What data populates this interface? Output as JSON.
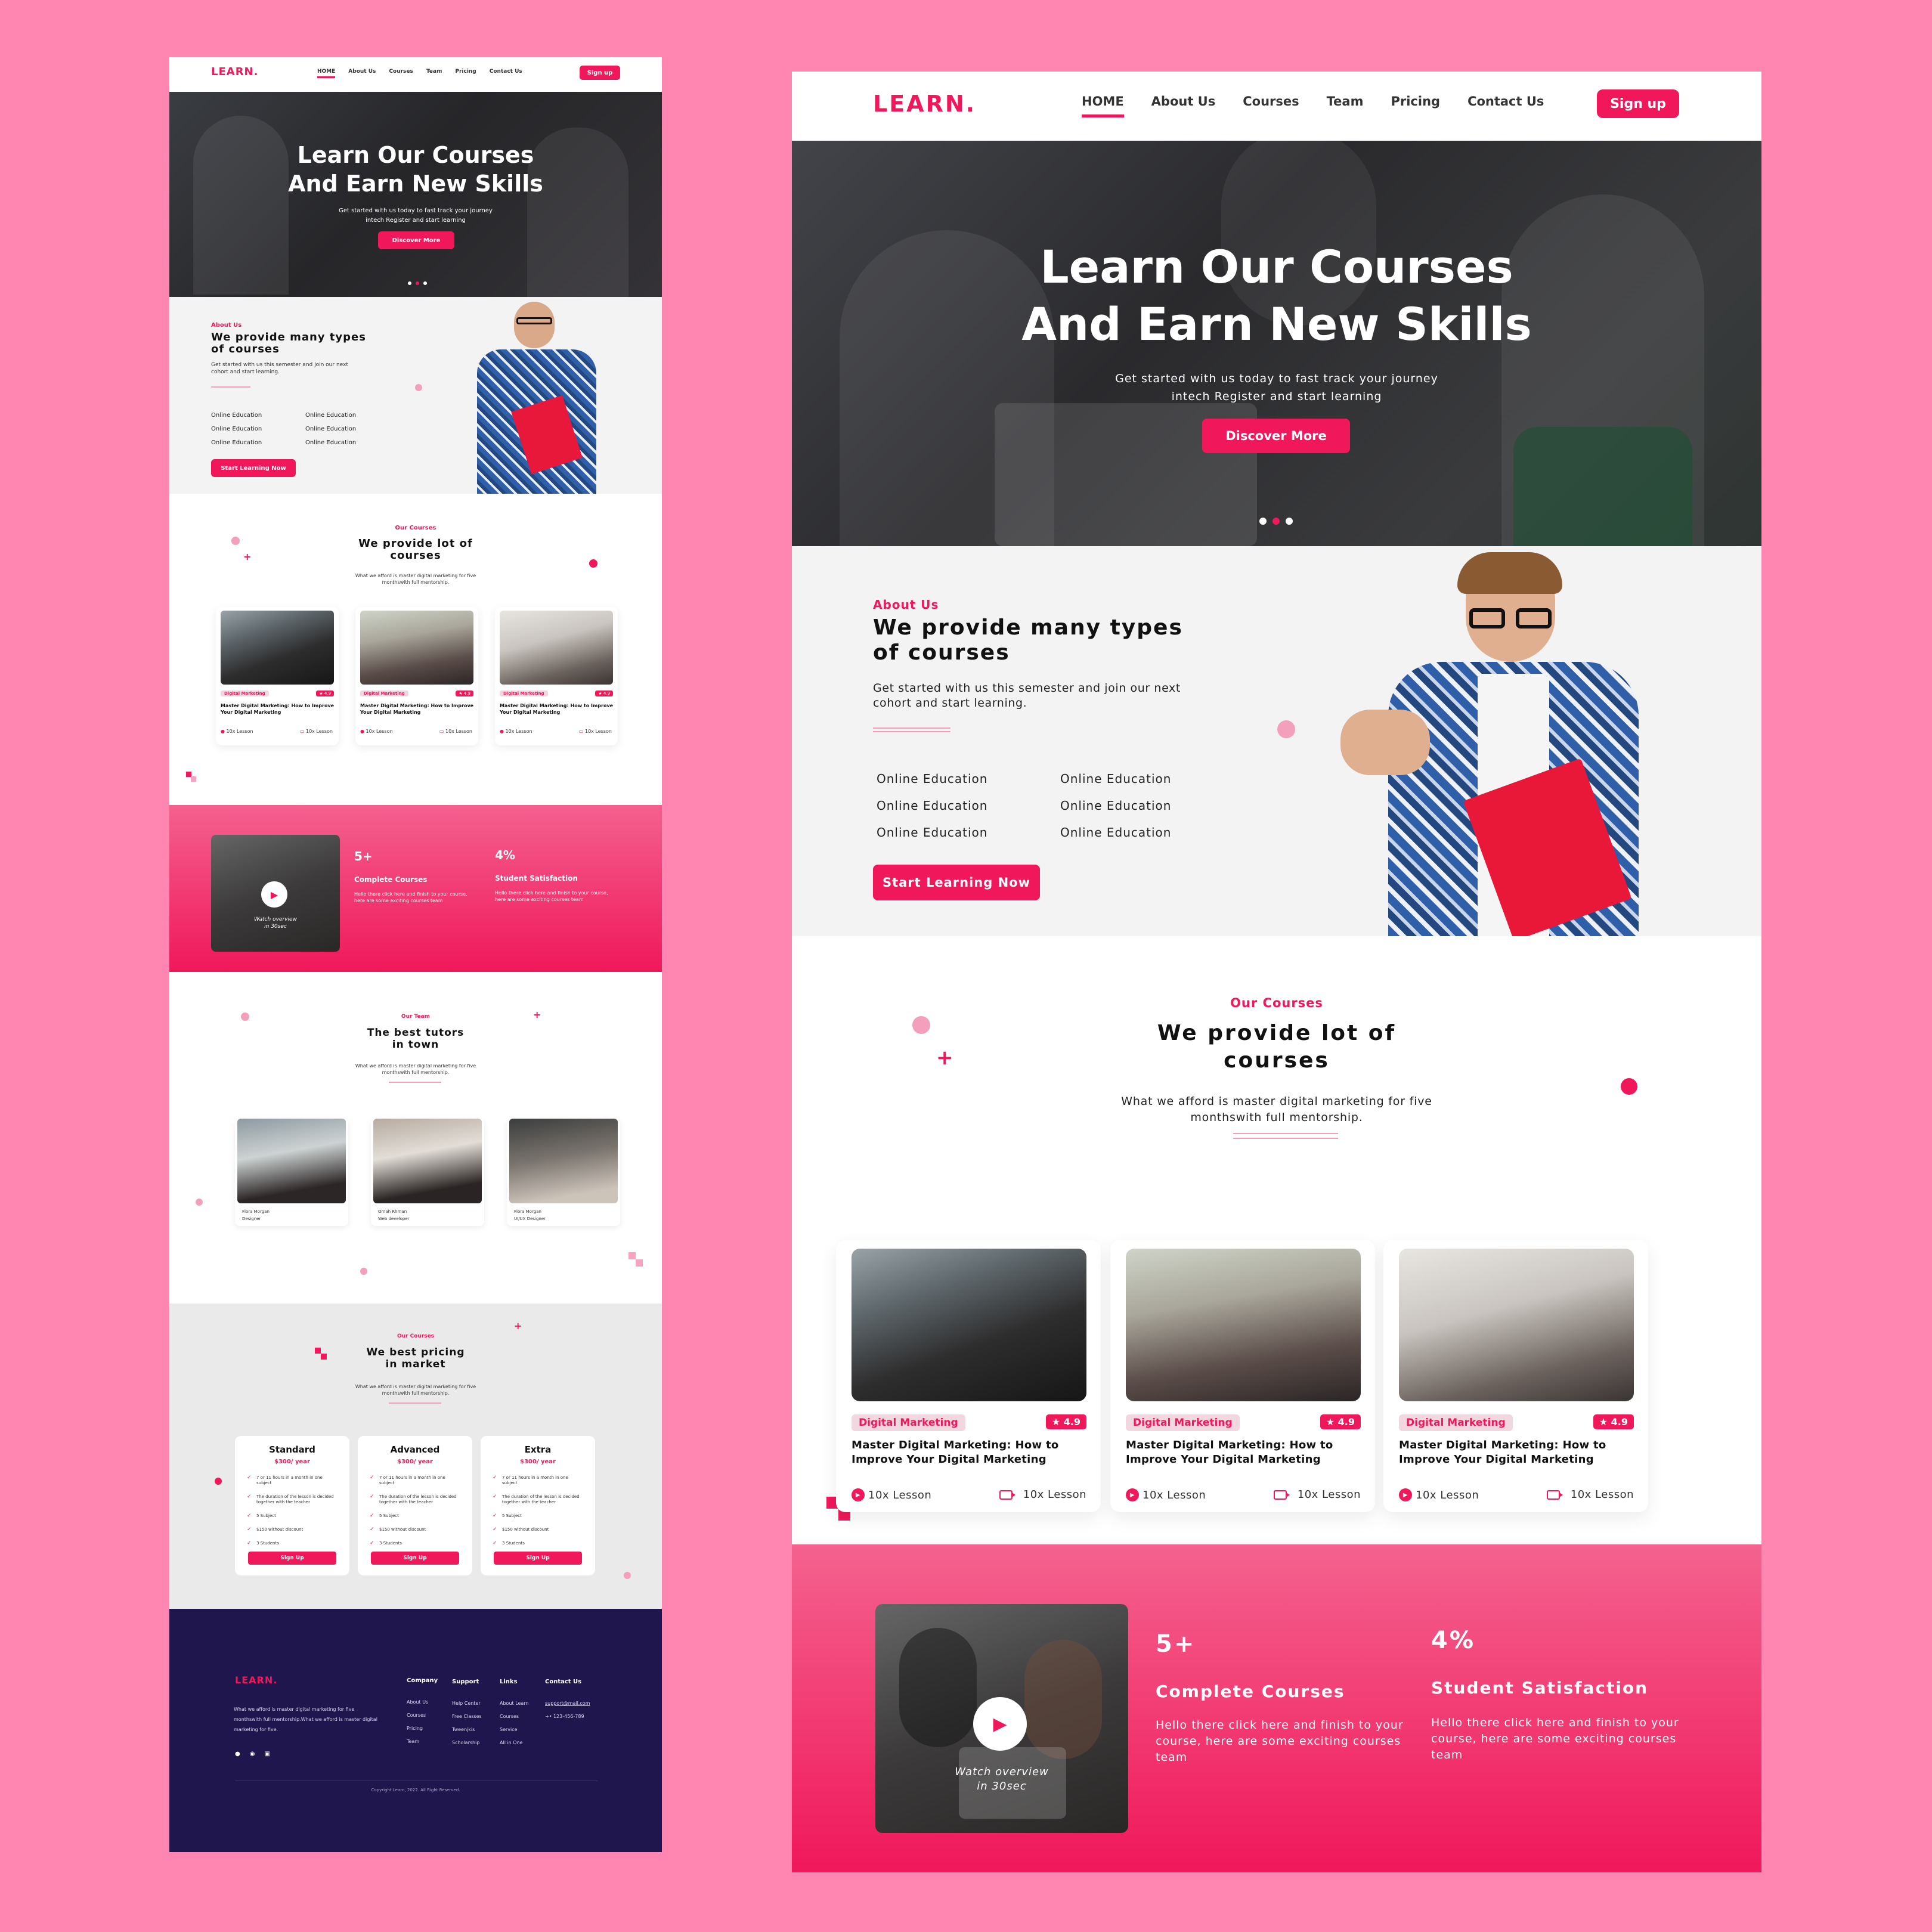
{
  "brand": {
    "logo": "LEARN.",
    "accent": "#f0185a",
    "footer_bg": "#1f164d",
    "page_bg": "#ff86b0"
  },
  "nav": {
    "items": [
      "HOME",
      "About Us",
      "Courses",
      "Team",
      "Pricing",
      "Contact Us"
    ],
    "signup": "Sign up"
  },
  "hero": {
    "title_line1": "Learn Our Courses",
    "title_line2": "And Earn New Skills",
    "subtitle_line1": "Get started with us today to fast track your journey",
    "subtitle_line2": "intech Register and start learning",
    "cta": "Discover More"
  },
  "about": {
    "label": "About Us",
    "title_line1": "We provide many types",
    "title_line2": "of courses",
    "text_line1": "Get started with us this semester and join our next",
    "text_line2": "cohort and start learning.",
    "items": [
      "Online Education",
      "Online Education",
      "Online Education",
      "Online Education",
      "Online Education",
      "Online Education"
    ],
    "cta": "Start Learning Now"
  },
  "courses": {
    "label": "Our Courses",
    "title_line1": "We provide lot of",
    "title_line2": "courses",
    "text_line1": "What we afford is master digital marketing for five",
    "text_line2": "monthswith full mentorship.",
    "cards": [
      {
        "tag": "Digital Marketing",
        "rating": "4.9",
        "title": "Master Digital Marketing: How to Improve Your Digital Marketing",
        "lesson1": "10x Lesson",
        "lesson2": "10x Lesson"
      },
      {
        "tag": "Digital Marketing",
        "rating": "4.9",
        "title": "Master Digital Marketing: How to Improve Your Digital Marketing",
        "lesson1": "10x Lesson",
        "lesson2": "10x Lesson"
      },
      {
        "tag": "Digital Marketing",
        "rating": "4.9",
        "title": "Master Digital Marketing: How to Improve Your Digital Marketing",
        "lesson1": "10x Lesson",
        "lesson2": "10x Lesson"
      }
    ]
  },
  "stats": {
    "video_caption_line1": "Watch overview",
    "video_caption_line2": "in 30sec",
    "items": [
      {
        "value": "5+",
        "label": "Complete Courses",
        "text": "Hello there click here and finish to your course, here are some exciting courses team"
      },
      {
        "value": "4%",
        "label": "Student Satisfaction",
        "text": "Hello there click here and finish to your course, here are some exciting courses team"
      }
    ]
  },
  "team": {
    "label": "Our Team",
    "title_line1": "The best tutors",
    "title_line2": "in town",
    "text_line1": "What we afford is master digital marketing for five",
    "text_line2": "monthswith full mentorship.",
    "members": [
      {
        "name": "Flora Morgan",
        "role": "Designer"
      },
      {
        "name": "Omah Rhman",
        "role": "Web developer"
      },
      {
        "name": "Flora Morgan",
        "role": "UI/UX Designer"
      }
    ]
  },
  "pricing": {
    "label": "Our Courses",
    "title_line1": "We best pricing",
    "title_line2": "in market",
    "text_line1": "What we afford is master digital marketing for five",
    "text_line2": "monthswith full mentorship.",
    "plans": [
      {
        "name": "Standard",
        "price": "$300/ year",
        "features": [
          "7 or 11 hours in a month in one subject",
          "The duration of the lesson is decided together with the teacher",
          "5 Subject",
          "$150 without discount",
          "3 Students"
        ],
        "cta": "Sign Up"
      },
      {
        "name": "Advanced",
        "price": "$300/ year",
        "features": [
          "7 or 11 hours in a month in one subject",
          "The duration of the lesson is decided together with the teacher",
          "5 Subject",
          "$150 without discount",
          "3 Students"
        ],
        "cta": "Sign Up"
      },
      {
        "name": "Extra",
        "price": "$300/ year",
        "features": [
          "7 or 11 hours in a month in one subject",
          "The duration of the lesson is decided together with the teacher",
          "5 Subject",
          "$150 without discount",
          "3 Students"
        ],
        "cta": "Sign Up"
      }
    ]
  },
  "footer": {
    "logo": "LEARN.",
    "text": "What we afford is master digital marketing for five monthswith full mentorship.What we afford is master digital marketing for five.",
    "columns": [
      {
        "title": "Company",
        "links": [
          "About Us",
          "Courses",
          "Pricing",
          "Team"
        ]
      },
      {
        "title": "Support",
        "links": [
          "Help Center",
          "Free Classes",
          "Tweenjkis",
          "Scholarship"
        ]
      },
      {
        "title": "Links",
        "links": [
          "About Learn",
          "Courses",
          "Service",
          "All in One"
        ]
      },
      {
        "title": "Contact Us",
        "links": [
          "support@mail.com",
          "+• 123-456-789"
        ]
      }
    ],
    "copyright": "Copyright Learn, 2022. All Right Reserved."
  }
}
